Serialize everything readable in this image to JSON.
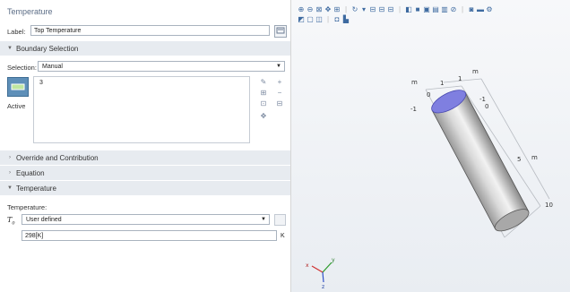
{
  "panel": {
    "title": "Temperature",
    "label_caption": "Label:",
    "label_value": "Top Temperature"
  },
  "boundary_selection": {
    "header": "Boundary Selection",
    "selection_caption": "Selection:",
    "selection_value": "Manual",
    "list_items": [
      "3"
    ],
    "active_label": "Active"
  },
  "sections": {
    "override": "Override and Contribution",
    "equation": "Equation",
    "temperature": "Temperature"
  },
  "temperature": {
    "caption": "Temperature:",
    "symbol": "T",
    "symbol_sub": "0",
    "type_value": "User defined",
    "value": "298[K]",
    "unit": "K"
  },
  "graphics": {
    "axis_labels": {
      "m_left": "m",
      "one_a": "1",
      "one_b": "1",
      "m_top": "m",
      "zero": "0",
      "minus_one_left": "-1",
      "minus_one_right": "-1",
      "zero_right": "0",
      "five": "5",
      "m_right": "m",
      "ten": "10"
    },
    "triad": {
      "x": "x",
      "y": "y",
      "z": "z"
    }
  }
}
